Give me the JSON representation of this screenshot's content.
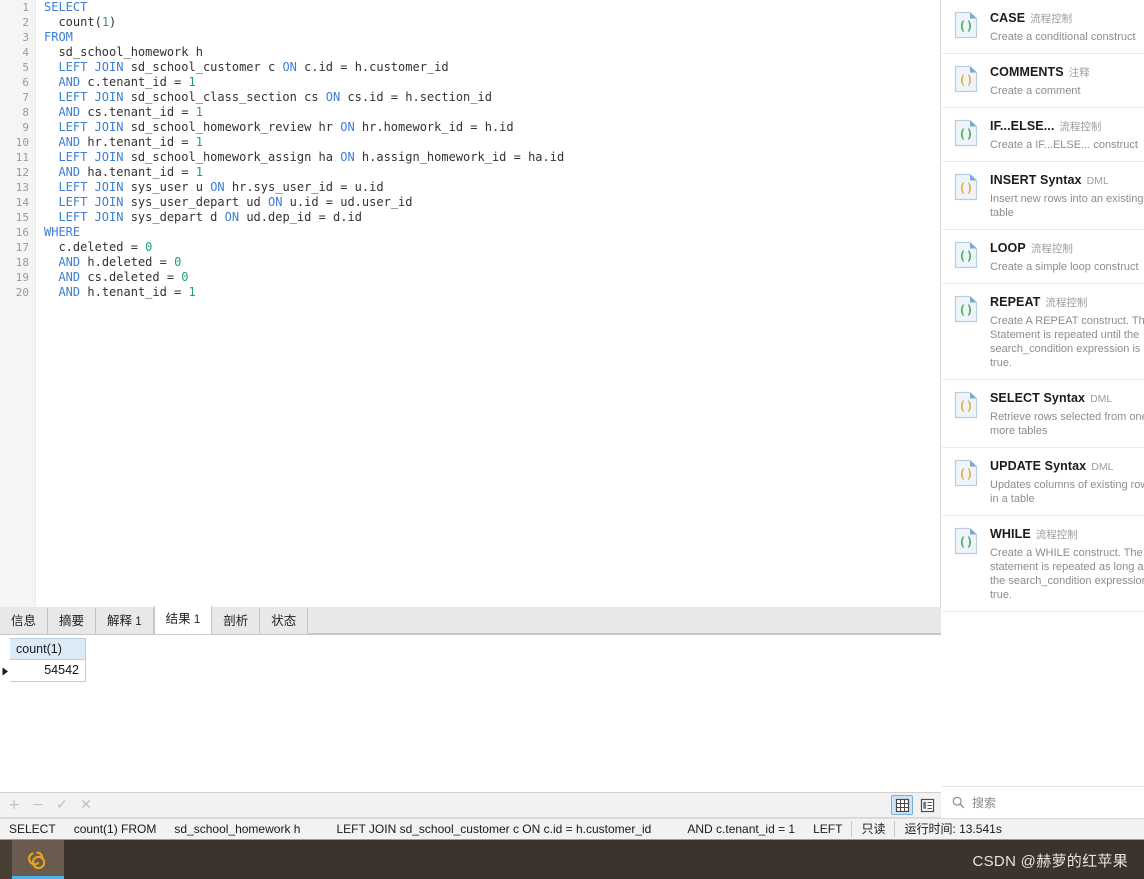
{
  "editor": {
    "language": "sql",
    "line_numbers": [
      1,
      2,
      3,
      4,
      5,
      6,
      7,
      8,
      9,
      10,
      11,
      12,
      13,
      14,
      15,
      16,
      17,
      18,
      19,
      20
    ],
    "lines": [
      {
        "n": 1,
        "indent": 0,
        "tokens": [
          {
            "t": "SELECT",
            "c": "kw"
          }
        ]
      },
      {
        "n": 2,
        "indent": 1,
        "tokens": [
          {
            "t": "count(",
            "c": "plain"
          },
          {
            "t": "1",
            "c": "num"
          },
          {
            "t": ")",
            "c": "plain"
          }
        ]
      },
      {
        "n": 3,
        "indent": 0,
        "tokens": [
          {
            "t": "FROM",
            "c": "kw"
          }
        ]
      },
      {
        "n": 4,
        "indent": 1,
        "tokens": [
          {
            "t": "sd_school_homework h",
            "c": "plain"
          }
        ]
      },
      {
        "n": 5,
        "indent": 1,
        "tokens": [
          {
            "t": "LEFT JOIN",
            "c": "kw"
          },
          {
            "t": " sd_school_customer c ",
            "c": "plain"
          },
          {
            "t": "ON",
            "c": "kw"
          },
          {
            "t": " c.id = h.customer_id",
            "c": "plain"
          }
        ]
      },
      {
        "n": 6,
        "indent": 1,
        "tokens": [
          {
            "t": "AND",
            "c": "kw"
          },
          {
            "t": " c.tenant_id = ",
            "c": "plain"
          },
          {
            "t": "1",
            "c": "num"
          }
        ]
      },
      {
        "n": 7,
        "indent": 1,
        "tokens": [
          {
            "t": "LEFT JOIN",
            "c": "kw"
          },
          {
            "t": " sd_school_class_section cs ",
            "c": "plain"
          },
          {
            "t": "ON",
            "c": "kw"
          },
          {
            "t": " cs.id = h.section_id",
            "c": "plain"
          }
        ]
      },
      {
        "n": 8,
        "indent": 1,
        "tokens": [
          {
            "t": "AND",
            "c": "kw"
          },
          {
            "t": " cs.tenant_id = ",
            "c": "plain"
          },
          {
            "t": "1",
            "c": "num"
          }
        ]
      },
      {
        "n": 9,
        "indent": 1,
        "tokens": [
          {
            "t": "LEFT JOIN",
            "c": "kw"
          },
          {
            "t": " sd_school_homework_review hr ",
            "c": "plain"
          },
          {
            "t": "ON",
            "c": "kw"
          },
          {
            "t": " hr.homework_id = h.id",
            "c": "plain"
          }
        ]
      },
      {
        "n": 10,
        "indent": 1,
        "tokens": [
          {
            "t": "AND",
            "c": "kw"
          },
          {
            "t": " hr.tenant_id = ",
            "c": "plain"
          },
          {
            "t": "1",
            "c": "num"
          }
        ]
      },
      {
        "n": 11,
        "indent": 1,
        "tokens": [
          {
            "t": "LEFT JOIN",
            "c": "kw"
          },
          {
            "t": " sd_school_homework_assign ha ",
            "c": "plain"
          },
          {
            "t": "ON",
            "c": "kw"
          },
          {
            "t": " h.assign_homework_id = ha.id",
            "c": "plain"
          }
        ]
      },
      {
        "n": 12,
        "indent": 1,
        "tokens": [
          {
            "t": "AND",
            "c": "kw"
          },
          {
            "t": " ha.tenant_id = ",
            "c": "plain"
          },
          {
            "t": "1",
            "c": "num"
          }
        ]
      },
      {
        "n": 13,
        "indent": 1,
        "tokens": [
          {
            "t": "LEFT JOIN",
            "c": "kw"
          },
          {
            "t": " sys_user u ",
            "c": "plain"
          },
          {
            "t": "ON",
            "c": "kw"
          },
          {
            "t": " hr.sys_user_id = u.id",
            "c": "plain"
          }
        ]
      },
      {
        "n": 14,
        "indent": 1,
        "tokens": [
          {
            "t": "LEFT JOIN",
            "c": "kw"
          },
          {
            "t": " sys_user_depart ud ",
            "c": "plain"
          },
          {
            "t": "ON",
            "c": "kw"
          },
          {
            "t": " u.id = ud.user_id",
            "c": "plain"
          }
        ]
      },
      {
        "n": 15,
        "indent": 1,
        "tokens": [
          {
            "t": "LEFT JOIN",
            "c": "kw"
          },
          {
            "t": " sys_depart d ",
            "c": "plain"
          },
          {
            "t": "ON",
            "c": "kw"
          },
          {
            "t": " ud.dep_id = d.id",
            "c": "plain"
          }
        ]
      },
      {
        "n": 16,
        "indent": 0,
        "tokens": [
          {
            "t": "WHERE",
            "c": "kw"
          }
        ]
      },
      {
        "n": 17,
        "indent": 1,
        "tokens": [
          {
            "t": "c.deleted = ",
            "c": "plain"
          },
          {
            "t": "0",
            "c": "num"
          }
        ]
      },
      {
        "n": 18,
        "indent": 1,
        "tokens": [
          {
            "t": "AND",
            "c": "kw"
          },
          {
            "t": " h.deleted = ",
            "c": "plain"
          },
          {
            "t": "0",
            "c": "num"
          }
        ]
      },
      {
        "n": 19,
        "indent": 1,
        "tokens": [
          {
            "t": "AND",
            "c": "kw"
          },
          {
            "t": " cs.deleted = ",
            "c": "plain"
          },
          {
            "t": "0",
            "c": "num"
          }
        ]
      },
      {
        "n": 20,
        "indent": 1,
        "tokens": [
          {
            "t": "AND",
            "c": "kw"
          },
          {
            "t": " h.tenant_id = ",
            "c": "plain"
          },
          {
            "t": "1",
            "c": "num"
          }
        ]
      }
    ]
  },
  "result_tabs": [
    {
      "label": "信息",
      "count": "",
      "active": false
    },
    {
      "label": "摘要",
      "count": "",
      "active": false
    },
    {
      "label": "解释",
      "count": "1",
      "active": false
    },
    {
      "label": "结果",
      "count": "1",
      "active": true
    },
    {
      "label": "剖析",
      "count": "",
      "active": false
    },
    {
      "label": "状态",
      "count": "",
      "active": false
    }
  ],
  "result_grid": {
    "columns": [
      "count(1)"
    ],
    "rows": [
      [
        "54542"
      ]
    ]
  },
  "record_toolbar": {
    "buttons": [
      {
        "name": "add-record-button",
        "glyph": "+"
      },
      {
        "name": "delete-record-button",
        "glyph": "−"
      },
      {
        "name": "apply-change-button",
        "glyph": "✓"
      },
      {
        "name": "cancel-change-button",
        "glyph": "✕"
      }
    ],
    "view_grid_label": "grid-view",
    "view_form_label": "form-view"
  },
  "statusbar": {
    "segments": [
      "SELECT",
      "count(1) FROM",
      "sd_school_homework h",
      "LEFT JOIN sd_school_customer c ON c.id = h.customer_id",
      "AND c.tenant_id = 1",
      "LEFT"
    ],
    "readonly": "只读",
    "runtime": "运行时间: 13.541s"
  },
  "snippets": {
    "search_placeholder": "搜索",
    "items": [
      {
        "title": "CASE",
        "category": "流程控制",
        "desc": "Create a conditional construct",
        "color": "green"
      },
      {
        "title": "COMMENTS",
        "category": "注释",
        "desc": "Create a comment",
        "color": "orange"
      },
      {
        "title": "IF...ELSE...",
        "category": "流程控制",
        "desc": "Create a IF...ELSE... construct",
        "color": "green"
      },
      {
        "title": "INSERT Syntax",
        "category": "DML",
        "desc": "Insert new rows into an existing table",
        "color": "orange"
      },
      {
        "title": "LOOP",
        "category": "流程控制",
        "desc": "Create a simple loop construct",
        "color": "green"
      },
      {
        "title": "REPEAT",
        "category": "流程控制",
        "desc": "Create A REPEAT construct. The Statement is repeated until the search_condition expression is true.",
        "color": "green"
      },
      {
        "title": "SELECT Syntax",
        "category": "DML",
        "desc": "Retrieve rows selected from one or more tables",
        "color": "orange"
      },
      {
        "title": "UPDATE Syntax",
        "category": "DML",
        "desc": "Updates columns of existing rows in a table",
        "color": "orange"
      },
      {
        "title": "WHILE",
        "category": "流程控制",
        "desc": "Create a WHILE construct. The statement is repeated as long as the search_condition expression is true.",
        "color": "green"
      }
    ]
  },
  "taskbar": {
    "app_name": "navicat",
    "watermark": "CSDN @赫萝的红苹果"
  },
  "colors": {
    "keyword": "#3c7fd4",
    "number": "#22a06b",
    "grid_header": "#dbeaf7",
    "accent": "#4bb3f0"
  }
}
